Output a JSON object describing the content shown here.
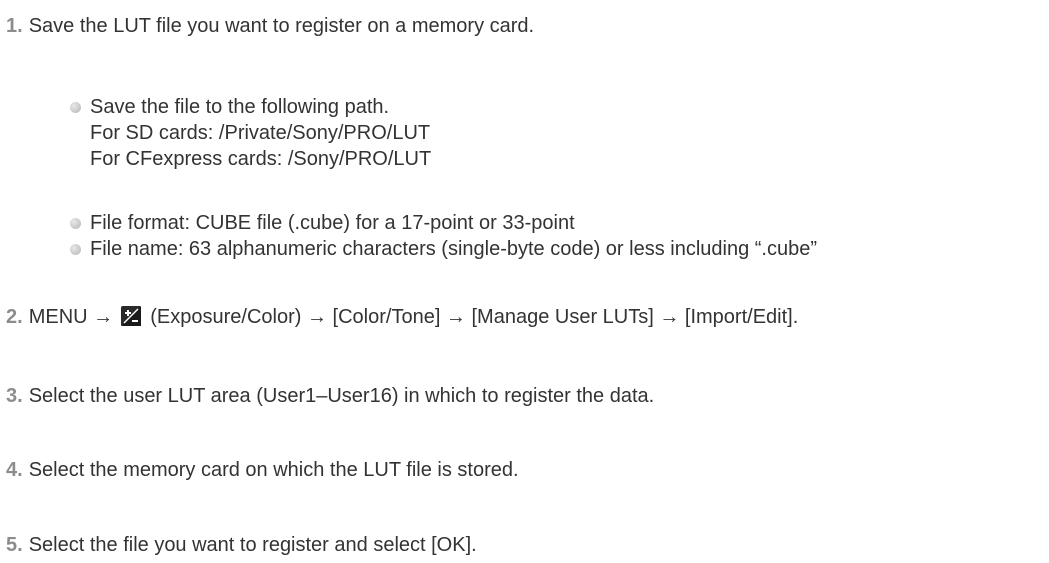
{
  "steps": [
    {
      "num": "1.",
      "text": "Save the LUT file you want to register on a memory card."
    },
    {
      "num": "2.",
      "pre": "MENU →",
      "icon": "exposure-compensation-icon",
      "post": "(Exposure/Color) → [Color/Tone] → [Manage User LUTs] → [Import/Edit]."
    },
    {
      "num": "3.",
      "text": "Select the user LUT area (User1–User16) in which to register the data."
    },
    {
      "num": "4.",
      "text": "Select the memory card on which the LUT file is stored."
    },
    {
      "num": "5.",
      "text": "Select the file you want to register and select [OK]."
    }
  ],
  "bullets": {
    "path_title": "Save the file to the following path.",
    "sd_path": "For SD cards: /Private/Sony/PRO/LUT",
    "cf_path": "For CFexpress cards: /Sony/PRO/LUT",
    "file_format": "File format: CUBE file (.cube) for a 17-point or 33-point",
    "file_name": "File name: 63 alphanumeric characters (single-byte code) or less including “.cube”"
  },
  "colors": {
    "text": "#333333",
    "step_number": "#8c8c8c",
    "icon_bg": "#2a2a2a"
  }
}
